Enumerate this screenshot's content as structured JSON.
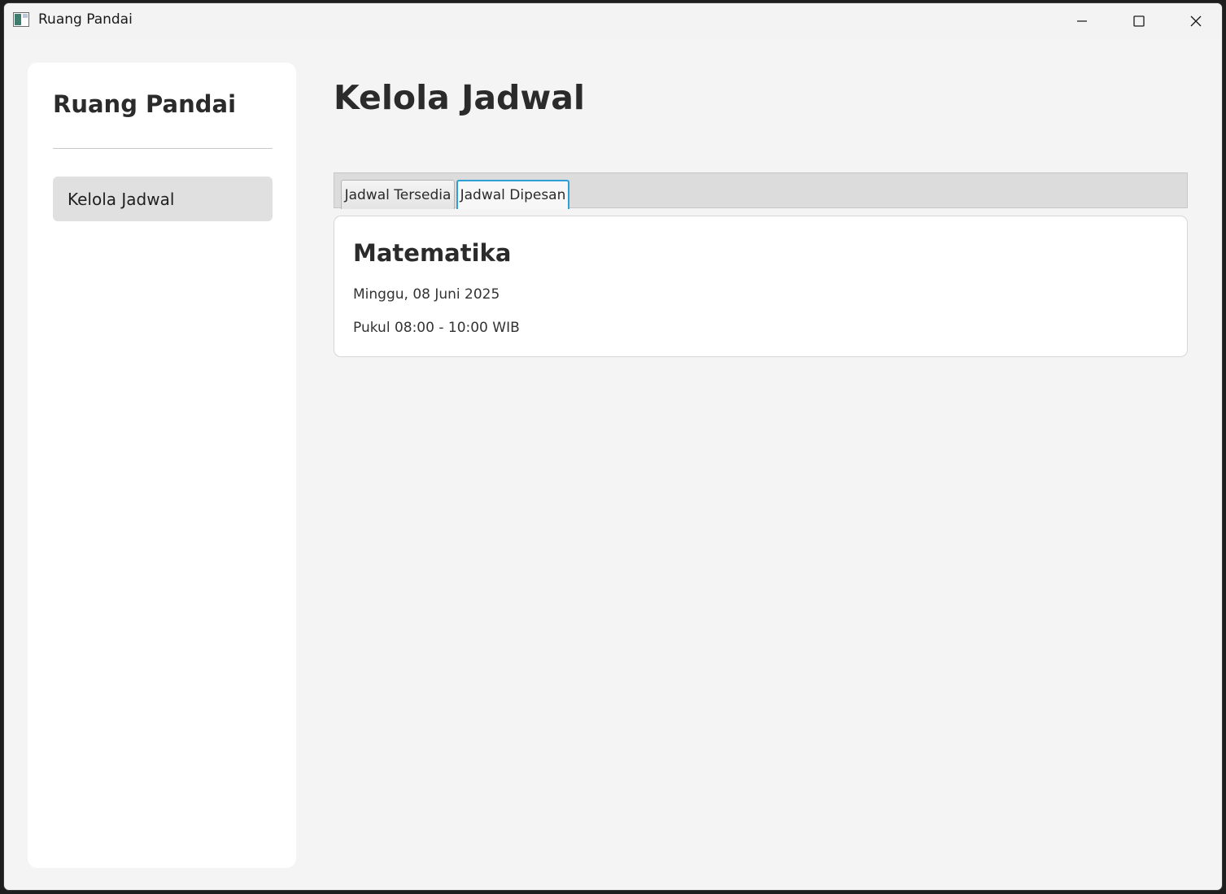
{
  "window": {
    "title": "Ruang Pandai"
  },
  "sidebar": {
    "title": "Ruang Pandai",
    "items": [
      {
        "label": "Kelola Jadwal"
      }
    ]
  },
  "main": {
    "title": "Kelola Jadwal",
    "tabs": [
      {
        "label": "Jadwal Tersedia",
        "selected": false
      },
      {
        "label": "Jadwal Dipesan",
        "selected": true
      }
    ],
    "cards": [
      {
        "subject": "Matematika",
        "date": "Minggu, 08 Juni 2025",
        "time": "Pukul 08:00 - 10:00 WIB"
      }
    ]
  },
  "colors": {
    "background": "#f4f4f4",
    "sidebar_background": "#ffffff",
    "sidebar_item_background": "#e0e0e0",
    "tab_header_background": "#dcdcdc",
    "selected_tab_border": "#2f9fd8",
    "text_primary": "#2b2b2b"
  },
  "icons": {
    "app": "app-icon",
    "minimize": "minimize-icon",
    "maximize": "maximize-icon",
    "close": "close-icon"
  }
}
